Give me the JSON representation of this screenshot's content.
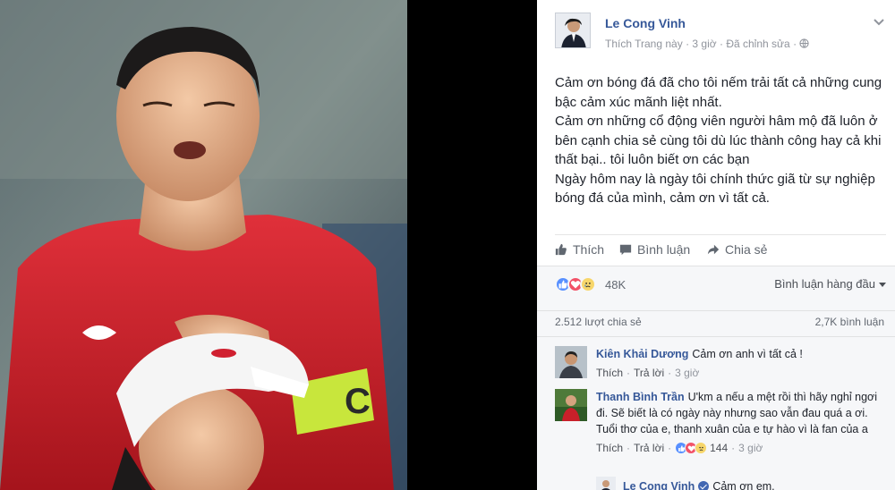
{
  "post": {
    "author": "Le Cong Vinh",
    "like_page": "Thích Trang này",
    "dot": "·",
    "time": "3 giờ",
    "edited": "Đã chỉnh sửa",
    "lines": [
      "Cảm ơn bóng đá đã cho tôi nếm trải tất cả những cung bậc cảm xúc mãnh liệt nhất.",
      "Cảm ơn những cổ động viên người hâm mộ đã luôn ở bên cạnh chia sẻ cùng tôi dù lúc thành công hay cả khi thất bại.. tôi luôn biết ơn các bạn",
      "Ngày hôm nay là ngày tôi chính thức giã từ sự nghiệp bóng đá của mình, cảm ơn vì tất cả."
    ]
  },
  "actions": {
    "like": "Thích",
    "comment": "Bình luận",
    "share": "Chia sẻ"
  },
  "reactions": {
    "count": "48K",
    "sort_label": "Bình luận hàng đầu"
  },
  "stats": {
    "shares": "2.512 lượt chia sẻ",
    "comments": "2,7K bình luận"
  },
  "comments": [
    {
      "name": "Kiên Khải Dương",
      "text": "Cảm ơn anh vì tất cả !",
      "like": "Thích",
      "reply": "Trả lời",
      "time": "3 giờ"
    },
    {
      "name": "Thanh Bình Trần",
      "text": "U'km a nếu a mệt rồi thì hãy nghỉ ngơi đi. Sẽ biết là có ngày này nhưng sao vẫn đau quá a ơi. Tuổi thơ của e, thanh xuân của e tự hào vì là fan của a",
      "like": "Thích",
      "reply": "Trả lời",
      "reaction_count": "144",
      "time": "3 giờ"
    },
    {
      "name": "Le Cong Vinh",
      "text": "Cảm ơn em."
    }
  ],
  "photo": {
    "armband_letter": "C"
  },
  "colors": {
    "link": "#365899",
    "like_blue": "#5890ff",
    "love_red": "#f25268",
    "sad_yellow": "#f7d66b",
    "jersey_red": "#d32027",
    "armband": "#c8e63c"
  }
}
